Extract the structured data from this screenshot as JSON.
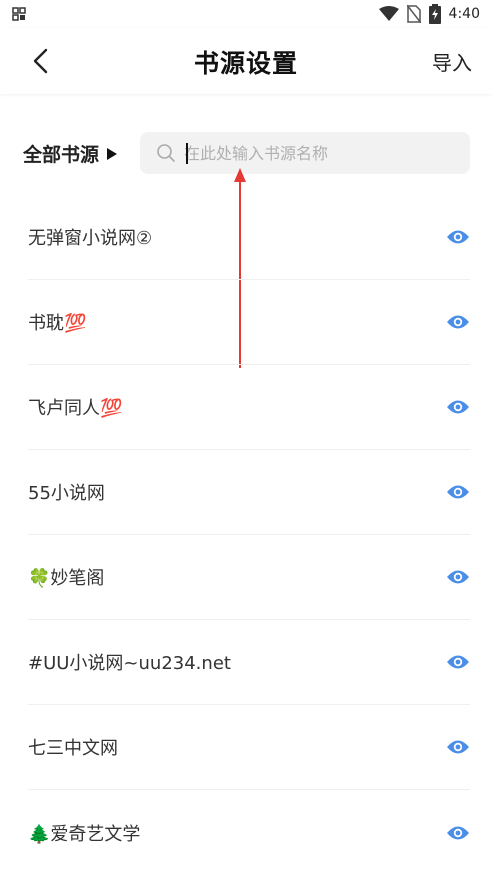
{
  "status_bar": {
    "time": "4:40",
    "icons": [
      "grid-notification-icon",
      "wifi-icon",
      "no-sim-icon",
      "battery-charging-icon"
    ]
  },
  "header": {
    "back_icon": "chevron-left-icon",
    "title": "书源设置",
    "import_label": "导入"
  },
  "filter": {
    "label": "全部书源",
    "search_placeholder": "在此处输入书源名称",
    "search_value": ""
  },
  "sources": [
    {
      "name": "无弹窗小说网②"
    },
    {
      "name": "书耽💯"
    },
    {
      "name": "飞卢同人💯"
    },
    {
      "name": "55小说网"
    },
    {
      "name": "🍀妙笔阁"
    },
    {
      "name": "#UU小说网~uu234.net"
    },
    {
      "name": "七三中文网"
    },
    {
      "name": "🌲爱奇艺文学"
    }
  ],
  "colors": {
    "accent": "#4a8ee8",
    "annotation": "#e53935",
    "search_bg": "#f2f2f2"
  }
}
